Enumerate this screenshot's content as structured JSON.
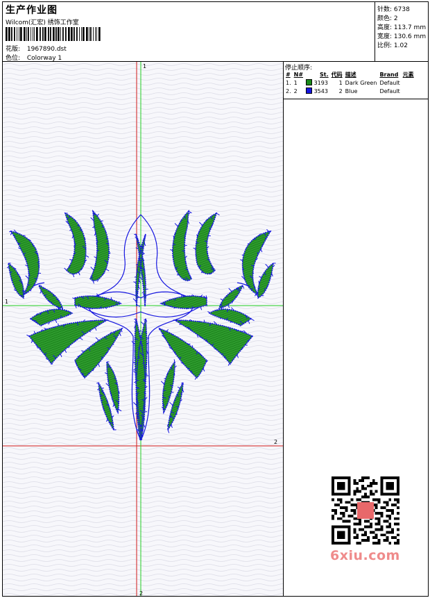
{
  "header": {
    "title": "生产作业图",
    "company": "Wilcom(汇宏) 绣饰工作室",
    "design": {
      "label": "花版:",
      "value": "1967890.dst"
    },
    "colorway": {
      "label": "色位:",
      "value": "Colorway 1"
    }
  },
  "stats": [
    {
      "label": "针数:",
      "value": "6738"
    },
    {
      "label": "颜色:",
      "value": "2"
    },
    {
      "label": "高度:",
      "value": "113.7 mm"
    },
    {
      "label": "宽度:",
      "value": "130.6 mm"
    },
    {
      "label": "比例:",
      "value": "1.02"
    }
  ],
  "stop_sequence": {
    "title": "停止顺序:",
    "columns": [
      "#",
      "N#",
      "St.",
      "代码",
      "描述",
      "Brand",
      "元素"
    ],
    "rows": [
      {
        "index": "1.",
        "n": "1",
        "color": "#1a8a1a",
        "stitches": "3193",
        "code": "1",
        "description": "Dark Green",
        "brand": "Default"
      },
      {
        "index": "2.",
        "n": "2",
        "color": "#1515e0",
        "stitches": "3543",
        "code": "2",
        "description": "Blue",
        "brand": "Default"
      }
    ]
  },
  "canvas": {
    "axis_v_top": "1",
    "axis_h_left": "1",
    "axis_v_bottom": "2",
    "axis_h_right": "2",
    "green": "#1a8a1a",
    "blue": "#1515e0",
    "red": "#d01818",
    "guide_green": "#22cc22"
  },
  "watermark": {
    "text": "6xiu.com",
    "qr_icon": "qr-code-icon"
  }
}
